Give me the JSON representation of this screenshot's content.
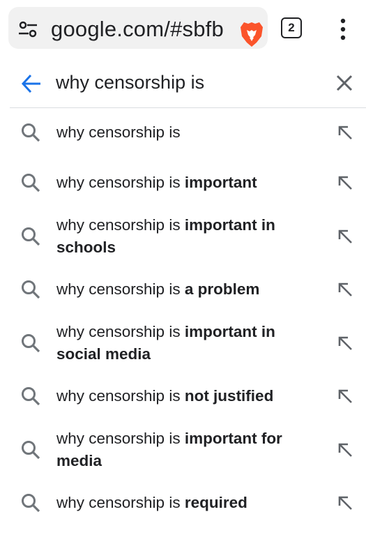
{
  "browser": {
    "url": "google.com/#sbfb",
    "tab_count": "2",
    "icons": [
      "tune-icon",
      "brave-lion-icon",
      "more-vert-icon"
    ]
  },
  "search": {
    "query": "why censorship is",
    "icons": [
      "back-arrow-icon",
      "clear-icon"
    ]
  },
  "suggestions": [
    {
      "prefix": "why censorship is",
      "completion": ""
    },
    {
      "prefix": "why censorship is ",
      "completion": "important"
    },
    {
      "prefix": "why censorship is ",
      "completion": "important in schools"
    },
    {
      "prefix": "why censorship is ",
      "completion": "a problem"
    },
    {
      "prefix": "why censorship is ",
      "completion": "important in social media"
    },
    {
      "prefix": "why censorship is ",
      "completion": "not justified"
    },
    {
      "prefix": "why censorship is ",
      "completion": "important for media"
    },
    {
      "prefix": "why censorship is ",
      "completion": "required"
    }
  ],
  "colors": {
    "accent_blue": "#1a73e8",
    "brave_orange": "#fb542b",
    "icon_gray": "#70757a"
  }
}
